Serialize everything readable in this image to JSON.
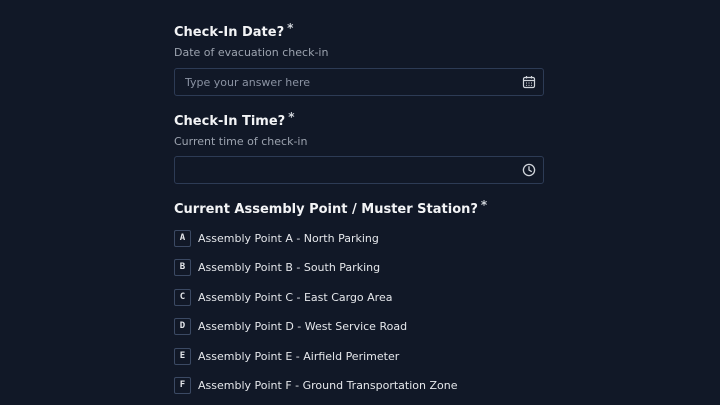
{
  "questions": {
    "checkin_date": {
      "title": "Check-In Date?",
      "required_mark": "*",
      "description": "Date of evacuation check-in",
      "placeholder": "Type your answer here",
      "icon": "calendar-icon"
    },
    "checkin_time": {
      "title": "Check-In Time?",
      "required_mark": "*",
      "description": "Current time of check-in",
      "placeholder": "",
      "icon": "clock-icon"
    },
    "assembly_point": {
      "title": "Current Assembly Point / Muster Station?",
      "required_mark": "*",
      "options": [
        {
          "key": "A",
          "label": "Assembly Point A - North Parking"
        },
        {
          "key": "B",
          "label": "Assembly Point B - South Parking"
        },
        {
          "key": "C",
          "label": "Assembly Point C - East Cargo Area"
        },
        {
          "key": "D",
          "label": "Assembly Point D - West Service Road"
        },
        {
          "key": "E",
          "label": "Assembly Point E - Airfield Perimeter"
        },
        {
          "key": "F",
          "label": "Assembly Point F - Ground Transportation Zone"
        }
      ]
    }
  },
  "colors": {
    "background": "#111827",
    "border": "#2d3b55",
    "text": "#e5e7eb",
    "muted": "#9ca3af"
  }
}
